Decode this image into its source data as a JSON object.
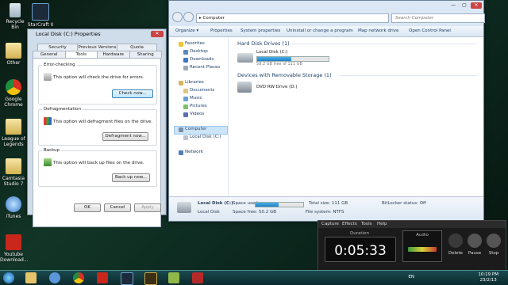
{
  "desktop": {
    "icons": [
      "Recycle Bin",
      "StarCraft II -",
      "Other",
      "Google Chrome",
      "League of Legends",
      "Camtasia Studio 7",
      "iTunes",
      "Youtube Download..."
    ]
  },
  "properties_dialog": {
    "title": "Local Disk (C:) Properties",
    "close_glyph": "✕",
    "tabs_row1": [
      "Security",
      "Previous Versions",
      "Quota"
    ],
    "tabs_row2": [
      "General",
      "Tools",
      "Hardware",
      "Sharing"
    ],
    "error_checking": {
      "label": "Error-checking",
      "text": "This option will check the drive for errors.",
      "button": "Check now..."
    },
    "defragmentation": {
      "label": "Defragmentation",
      "text": "This option will defragment files on the drive.",
      "button": "Defragment now..."
    },
    "backup": {
      "label": "Backup",
      "text": "This option will back up files on the drive.",
      "button": "Back up now..."
    },
    "footer": {
      "ok": "OK",
      "cancel": "Cancel",
      "apply": "Apply"
    }
  },
  "explorer": {
    "address": "Computer",
    "search_placeholder": "Search Computer",
    "window_controls": {
      "minimize": "—",
      "maximize": "▢",
      "close": "✕"
    },
    "toolbar": [
      "Organize ▾",
      "Properties",
      "System properties",
      "Uninstall or change a program",
      "Map network drive",
      "Open Control Panel"
    ],
    "nav": {
      "favorites_header": "Favorites",
      "favorites": [
        "Desktop",
        "Downloads",
        "Recent Places"
      ],
      "libraries_header": "Libraries",
      "libraries": [
        "Documents",
        "Music",
        "Pictures",
        "Videos"
      ],
      "computer_header": "Computer",
      "computer_items": [
        "Local Disk (C:)"
      ],
      "network": "Network"
    },
    "hard_disk_section": "Hard Disk Drives (1)",
    "drive": {
      "name": "Local Disk (C:)",
      "free_text": "58.2 GB free of 111 GB",
      "used_fraction": 0.48
    },
    "removable_section": "Devices with Removable Storage (1)",
    "dvd": "DVD RW Drive (D:)",
    "details": {
      "name": "Local Disk (C:)",
      "type": "Local Disk",
      "space_used_label": "Space used:",
      "space_free": "Space free: 50.2 GB",
      "total_size": "Total size: 111 GB",
      "file_system": "File system: NTFS",
      "bitlocker": "BitLocker status: Off"
    }
  },
  "recorder": {
    "menu": [
      "Capture",
      "Effects",
      "Tools",
      "Help"
    ],
    "duration_label": "Duration",
    "time": "0:05:33",
    "audio_label": "Audio",
    "buttons": [
      "Delete",
      "Pause",
      "Stop"
    ]
  },
  "taskbar": {
    "language": "EN",
    "time": "10:19 PM",
    "date": "23/2/13"
  }
}
